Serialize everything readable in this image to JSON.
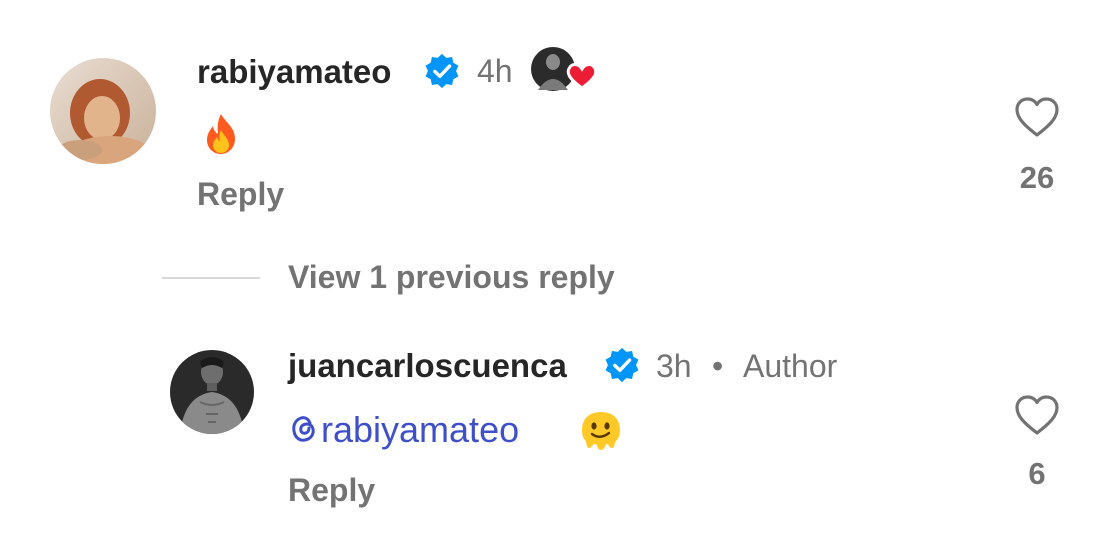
{
  "comments": [
    {
      "username": "rabiyamateo",
      "verified": true,
      "time": "4h",
      "emoji": "fire-emoji",
      "reply_label": "Reply",
      "likes": "26",
      "liked_by_author": true
    },
    {
      "username": "juancarloscuenca",
      "verified": true,
      "time": "3h",
      "separator": "•",
      "badge": "Author",
      "mention": "rabiyamateo",
      "mention_icon": "threads-icon",
      "emoji": "melting-face-emoji",
      "reply_label": "Reply",
      "likes": "6"
    }
  ],
  "view_replies_label": "View 1 previous reply",
  "colors": {
    "verified": "#0095f6",
    "mention": "#3f4fc9",
    "heart_red": "#ed1c35",
    "muted_text": "#737373"
  }
}
